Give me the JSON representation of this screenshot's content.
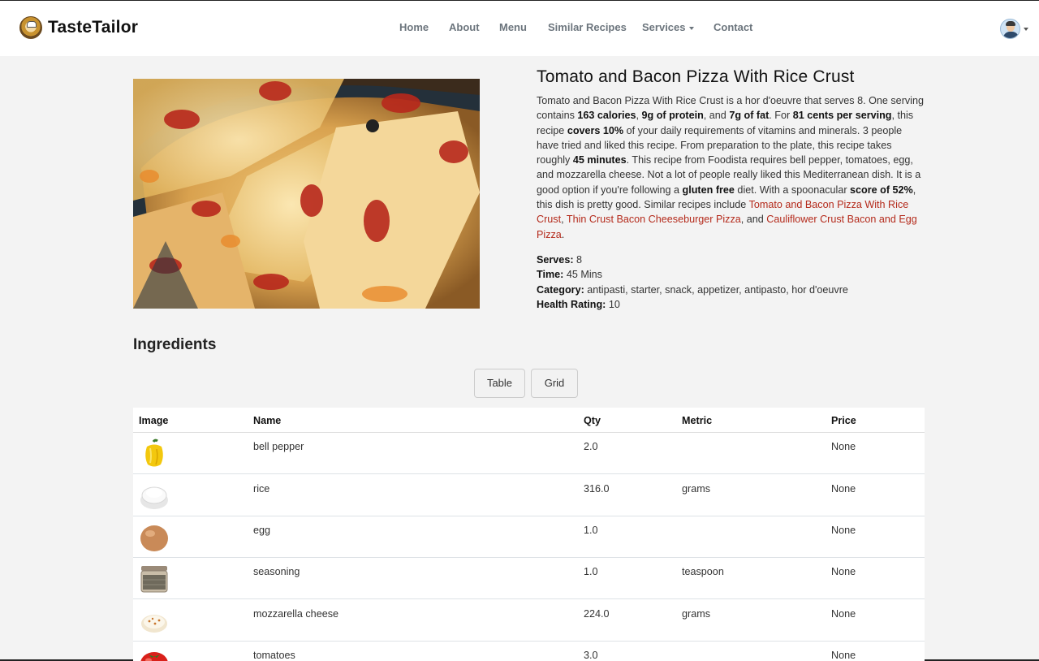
{
  "brand": {
    "name": "TasteTailor"
  },
  "nav": {
    "home": "Home",
    "about": "About",
    "menu": "Menu",
    "similar": "Similar Recipes",
    "services": "Services",
    "contact": "Contact"
  },
  "recipe": {
    "title": "Tomato and Bacon Pizza With Rice Crust",
    "summary": {
      "p1": "Tomato and Bacon Pizza With Rice Crust is a hor d'oeuvre that serves 8. One serving contains ",
      "calories": "163 calories",
      "sep1": ", ",
      "protein": "9g of protein",
      "sep2": ", and ",
      "fat": "7g of fat",
      "p2": ". For ",
      "cost": "81 cents per serving",
      "p3": ", this recipe ",
      "covers": "covers 10%",
      "p4": " of your daily requirements of vitamins and minerals. 3 people have tried and liked this recipe. From preparation to the plate, this recipe takes roughly ",
      "time": "45 minutes",
      "p5": ". This recipe from Foodista requires bell pepper, tomatoes, egg, and mozzarella cheese. Not a lot of people really liked this Mediterranean dish. It is a good option if you're following a ",
      "gluten": "gluten free",
      "p6": " diet. With a spoonacular ",
      "score": "score of 52%",
      "p7": ", this dish is pretty good. Similar recipes include ",
      "link1": "Tomato and Bacon Pizza With Rice Crust",
      "sep3": ", ",
      "link2": "Thin Crust Bacon Cheeseburger Pizza",
      "sep4": ", and ",
      "link3": "Cauliflower Crust Bacon and Egg Pizza",
      "end": "."
    },
    "facts": {
      "serves_label": "Serves:",
      "serves": " 8",
      "time_label": "Time:",
      "time": " 45 Mins",
      "category_label": "Category:",
      "category": " antipasti, starter, snack, appetizer, antipasto, hor d'oeuvre",
      "health_label": "Health Rating:",
      "health": " 10"
    }
  },
  "ingredients": {
    "title": "Ingredients",
    "buttons": {
      "table": "Table",
      "grid": "Grid"
    },
    "columns": [
      "Image",
      "Name",
      "Qty",
      "Metric",
      "Price"
    ],
    "rows": [
      {
        "name": "bell pepper",
        "qty": "2.0",
        "metric": "",
        "price": "None",
        "icon": "bell-pepper-icon"
      },
      {
        "name": "rice",
        "qty": "316.0",
        "metric": "grams",
        "price": "None",
        "icon": "rice-icon"
      },
      {
        "name": "egg",
        "qty": "1.0",
        "metric": "",
        "price": "None",
        "icon": "egg-icon"
      },
      {
        "name": "seasoning",
        "qty": "1.0",
        "metric": "teaspoon",
        "price": "None",
        "icon": "seasoning-jar-icon"
      },
      {
        "name": "mozzarella cheese",
        "qty": "224.0",
        "metric": "grams",
        "price": "None",
        "icon": "mozzarella-icon"
      },
      {
        "name": "tomatoes",
        "qty": "3.0",
        "metric": "",
        "price": "None",
        "icon": "tomato-icon"
      }
    ]
  },
  "colors": {
    "link": "#b42a1b",
    "nav_text": "#6c757d",
    "background": "#f3f3f3"
  }
}
